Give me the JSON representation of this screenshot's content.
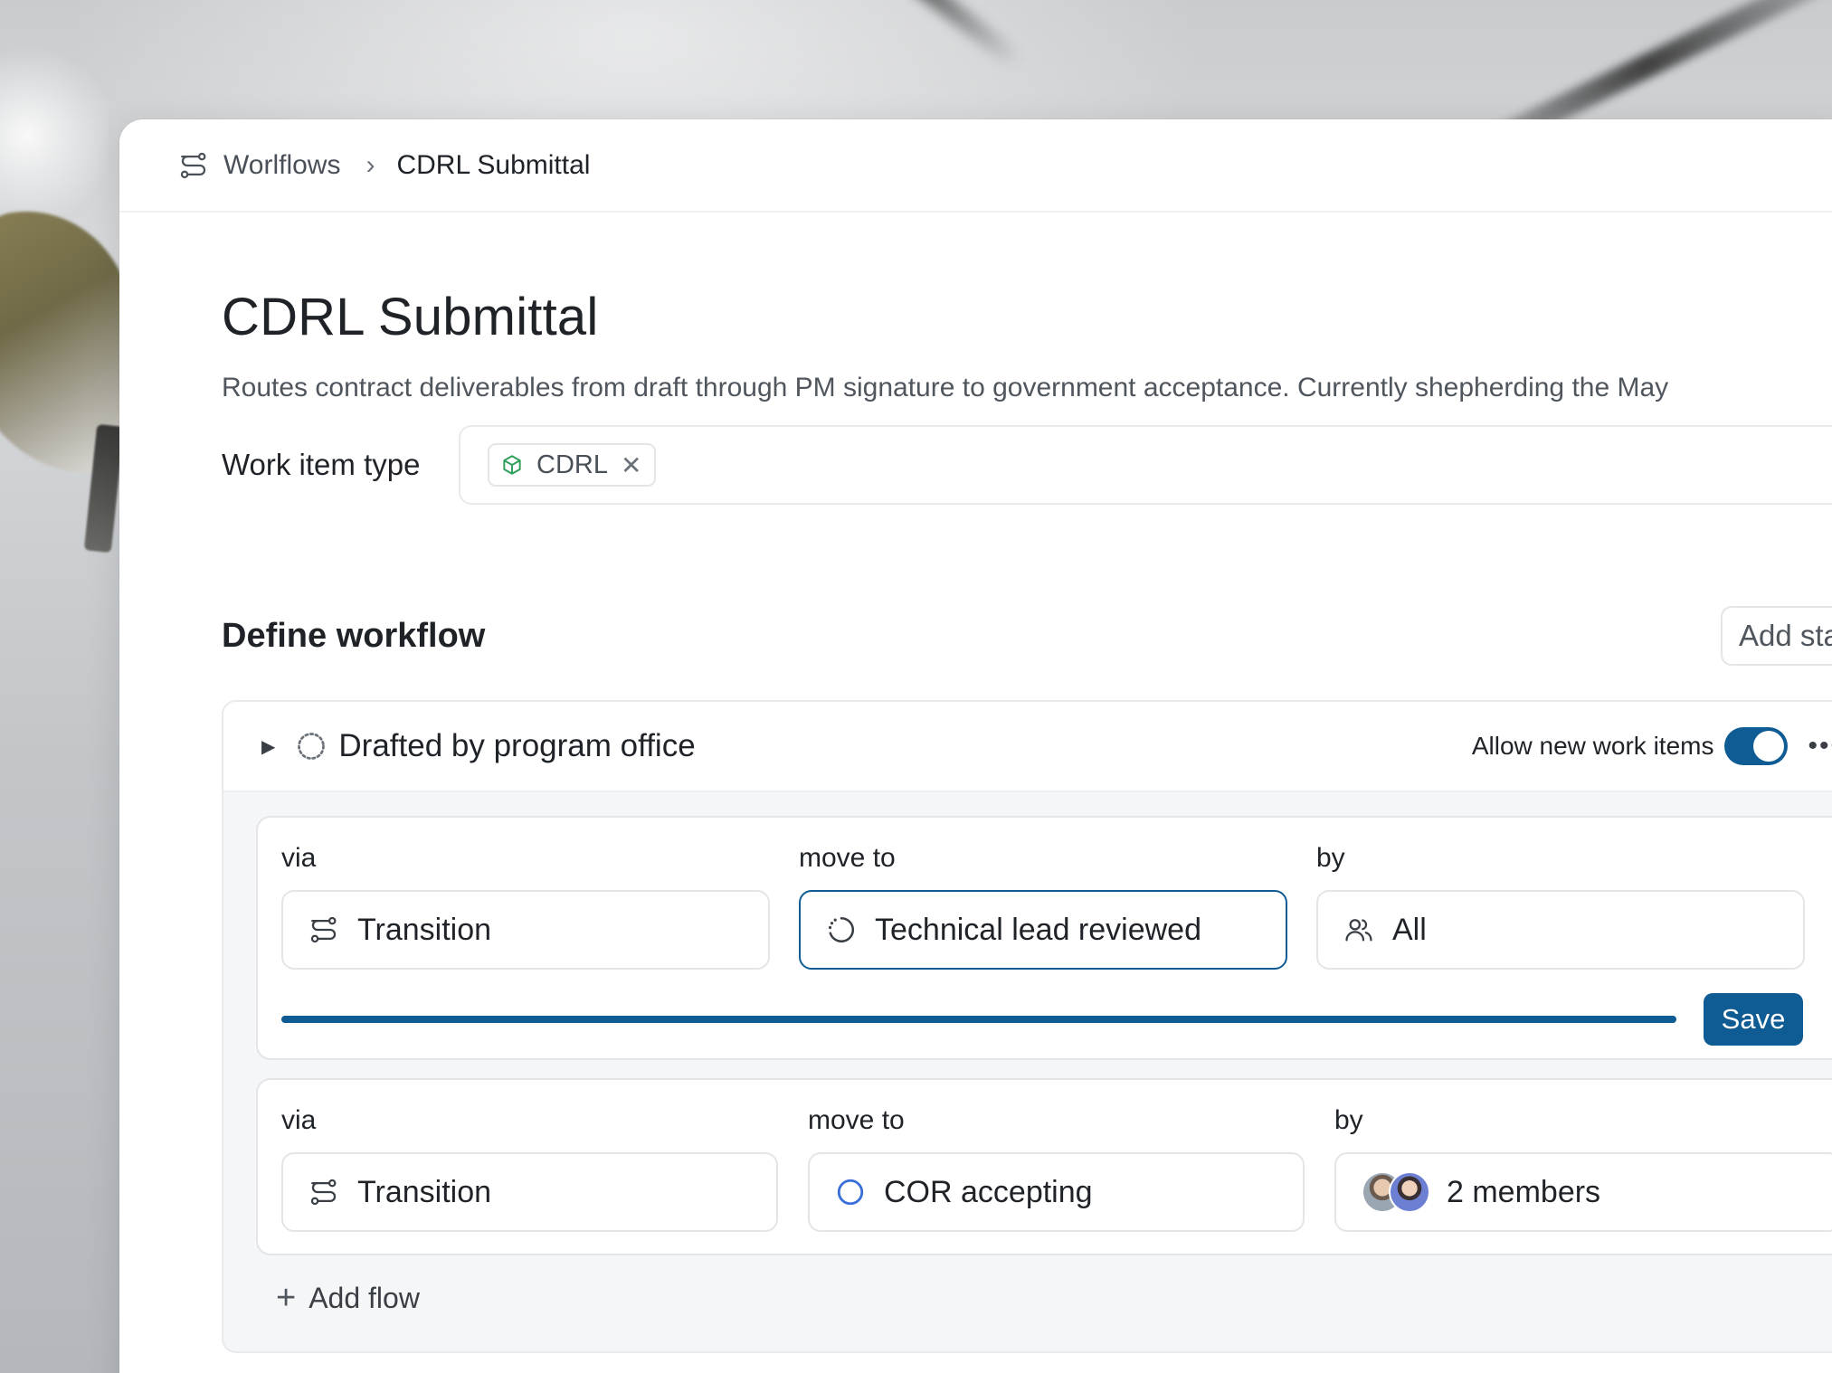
{
  "breadcrumb": {
    "root": "Worlflows",
    "separator": "›",
    "current": "CDRL Submittal"
  },
  "page": {
    "title": "CDRL Submittal",
    "description": "Routes contract deliverables from draft through PM signature to government acceptance. Currently shepherding the May"
  },
  "work_item_type": {
    "label": "Work item type",
    "chip": "CDRL",
    "chip_remove": "✕"
  },
  "define_workflow": {
    "title": "Define workflow",
    "add_state_label": "Add stat"
  },
  "state": {
    "name": "Drafted by program office",
    "allow_label": "Allow new work items",
    "allow_enabled": true,
    "more": "•••"
  },
  "flows": [
    {
      "via_label": "via",
      "via_value": "Transition",
      "move_label": "move to",
      "move_value": "Technical lead reviewed",
      "by_label": "by",
      "by_value": "All",
      "progress": 1.0,
      "save_label": "Save"
    },
    {
      "via_label": "via",
      "via_value": "Transition",
      "move_label": "move to",
      "move_value": "COR accepting",
      "by_label": "by",
      "by_value": "2 members"
    }
  ],
  "add_flow": {
    "plus": "+",
    "label": "Add flow"
  },
  "colors": {
    "accent": "#0e5c93",
    "chip_icon": "#2f9e5b",
    "cor_ring": "#3a6fd8"
  },
  "icons": {
    "breadcrumb": "workflow-icon",
    "chip": "cube-icon",
    "state": "dashed-circle-icon",
    "via": "workflow-icon",
    "move_to_1": "progress-circle-icon",
    "move_to_2": "ring-icon",
    "by_1": "users-icon"
  }
}
